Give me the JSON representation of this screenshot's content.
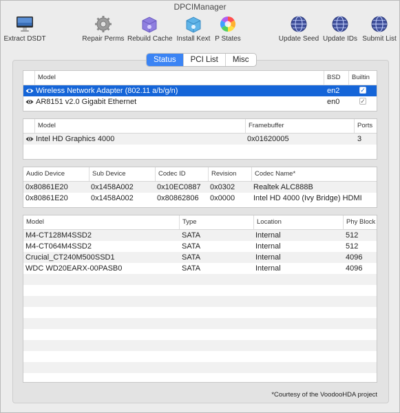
{
  "window": {
    "title": "DPCIManager"
  },
  "toolbar": {
    "items": [
      {
        "label": "Extract DSDT",
        "icon": "imac-icon"
      },
      {
        "label": "Repair Perms",
        "icon": "gear-icon"
      },
      {
        "label": "Rebuild Cache",
        "icon": "purple-box-icon"
      },
      {
        "label": "Install Kext",
        "icon": "blue-box-icon"
      },
      {
        "label": "P States",
        "icon": "color-wheel-icon"
      },
      {
        "label": "Update Seed",
        "icon": "globe-icon"
      },
      {
        "label": "Update IDs",
        "icon": "globe-icon"
      },
      {
        "label": "Submit List",
        "icon": "globe-icon"
      }
    ]
  },
  "tabs": [
    {
      "label": "Status",
      "active": true
    },
    {
      "label": "PCI List",
      "active": false
    },
    {
      "label": "Misc",
      "active": false
    }
  ],
  "network": {
    "headers": [
      "Model",
      "BSD",
      "Builtin"
    ],
    "rows": [
      {
        "model": "Wireless Network Adapter (802.11 a/b/g/n)",
        "bsd": "en2",
        "builtin": true,
        "selected": true
      },
      {
        "model": "AR8151 v2.0 Gigabit Ethernet",
        "bsd": "en0",
        "builtin": true,
        "selected": false
      }
    ]
  },
  "graphics": {
    "headers": [
      "Model",
      "Framebuffer",
      "Ports"
    ],
    "rows": [
      {
        "model": "Intel HD Graphics 4000",
        "framebuffer": "0x01620005",
        "ports": "3"
      }
    ]
  },
  "audio": {
    "headers": [
      "Audio Device",
      "Sub Device",
      "Codec ID",
      "Revision",
      "Codec Name*"
    ],
    "rows": [
      {
        "audio_device": "0x80861E20",
        "sub_device": "0x1458A002",
        "codec_id": "0x10EC0887",
        "revision": "0x0302",
        "codec_name": "Realtek ALC888B"
      },
      {
        "audio_device": "0x80861E20",
        "sub_device": "0x1458A002",
        "codec_id": "0x80862806",
        "revision": "0x0000",
        "codec_name": "Intel HD 4000 (Ivy Bridge) HDMI"
      }
    ]
  },
  "storage": {
    "headers": [
      "Model",
      "Type",
      "Location",
      "Phy Block"
    ],
    "rows": [
      {
        "model": "M4-CT128M4SSD2",
        "type": "SATA",
        "location": "Internal",
        "phy_block": "512"
      },
      {
        "model": "M4-CT064M4SSD2",
        "type": "SATA",
        "location": "Internal",
        "phy_block": "512"
      },
      {
        "model": "Crucial_CT240M500SSD1",
        "type": "SATA",
        "location": "Internal",
        "phy_block": "4096"
      },
      {
        "model": "WDC WD20EARX-00PASB0",
        "type": "SATA",
        "location": "Internal",
        "phy_block": "4096"
      }
    ]
  },
  "footnote": "*Courtesy of the VoodooHDA project",
  "colors": {
    "selection": "#1565d8",
    "tab_active": "#3b84f4"
  }
}
